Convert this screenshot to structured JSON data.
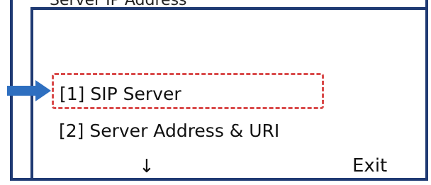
{
  "screen": {
    "title": "Server IP Address",
    "menu": [
      {
        "label": "[1] SIP Server"
      },
      {
        "label": "[2] Server Address & URI"
      }
    ],
    "nav": {
      "down_label": "↓",
      "exit_label": "Exit"
    }
  },
  "colors": {
    "frame": "#1f3a73",
    "pointer_arrow": "#2e6fc0",
    "highlight": "#d94a4a"
  },
  "icons": {
    "pointer": "arrow-right-icon"
  }
}
